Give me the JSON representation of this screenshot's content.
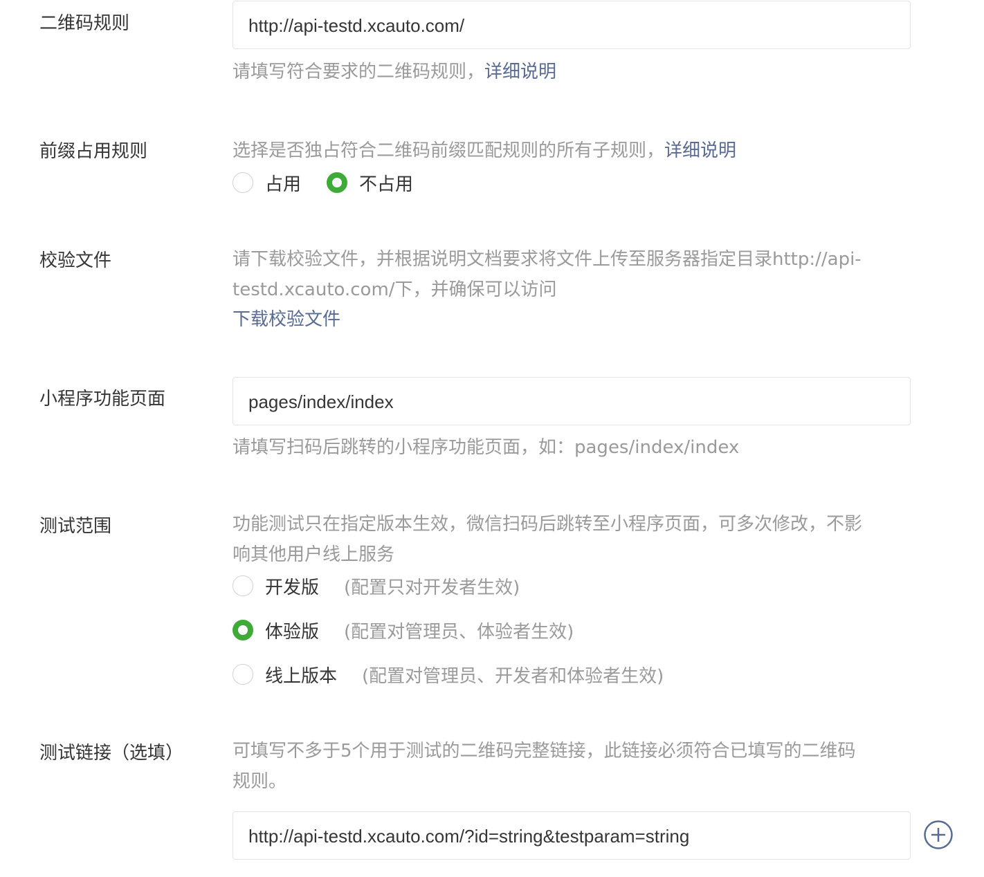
{
  "qrcode_rule": {
    "label": "二维码规则",
    "value": "http://api-testd.xcauto.com/",
    "tip": "请填写符合要求的二维码规则，",
    "tip_link": "详细说明"
  },
  "prefix_rule": {
    "label": "前缀占用规则",
    "tip": "选择是否独占符合二维码前缀匹配规则的所有子规则，",
    "tip_link": "详细说明",
    "options": [
      {
        "label": "占用",
        "checked": false
      },
      {
        "label": "不占用",
        "checked": true
      }
    ]
  },
  "verify_file": {
    "label": "校验文件",
    "tip_line1": "请下载校验文件，并根据说明文档要求将文件上传至服务器指定目录http://api-",
    "tip_line2": "testd.xcauto.com/下，并确保可以访问",
    "download_link": "下载校验文件"
  },
  "page_path": {
    "label": "小程序功能页面",
    "value": "pages/index/index",
    "tip": "请填写扫码后跳转的小程序功能页面，如：pages/index/index"
  },
  "test_scope": {
    "label": "测试范围",
    "tip_line1": "功能测试只在指定版本生效，微信扫码后跳转至小程序页面，可多次修改，不影",
    "tip_line2": "响其他用户线上服务",
    "options": [
      {
        "label": "开发版",
        "note": "(配置只对开发者生效)",
        "checked": false
      },
      {
        "label": "体验版",
        "note": "(配置对管理员、体验者生效)",
        "checked": true
      },
      {
        "label": "线上版本",
        "note": "(配置对管理员、开发者和体验者生效)",
        "checked": false
      }
    ]
  },
  "test_links": {
    "label": "测试链接（选填）",
    "tip_line1": "可填写不多于5个用于测试的二维码完整链接，此链接必须符合已填写的二维码",
    "tip_line2": "规则。",
    "value": "http://api-testd.xcauto.com/?id=string&testparam=string",
    "add_icon": "plus-circle-icon"
  },
  "colors": {
    "accent_green": "#3eab38",
    "link_blue": "#576b95",
    "tip_gray": "#9a9a9a",
    "text": "#353535"
  }
}
